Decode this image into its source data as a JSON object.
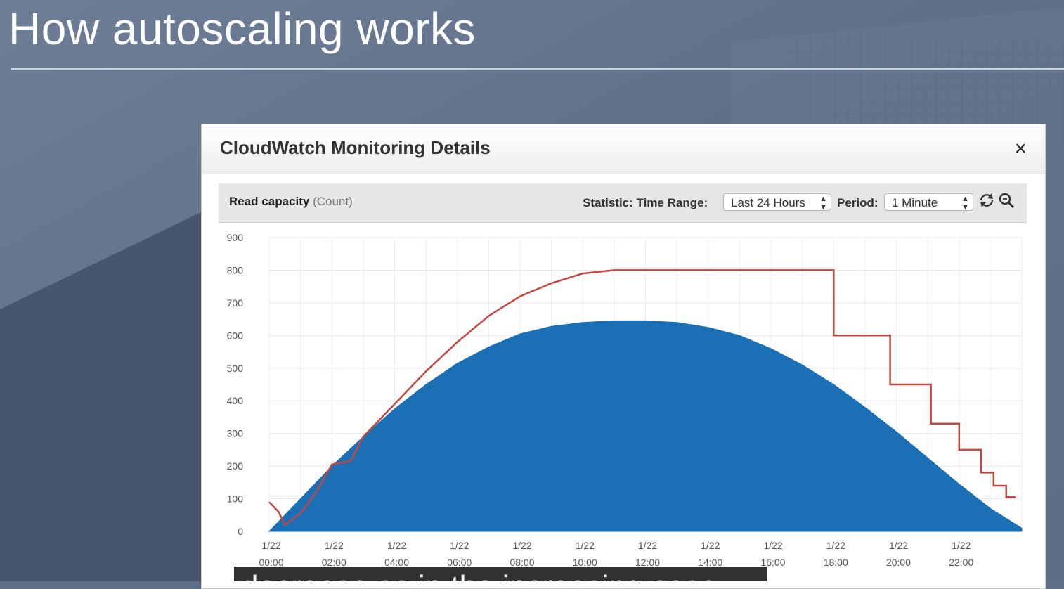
{
  "slide": {
    "title": "How autoscaling works"
  },
  "dialog": {
    "title": "CloudWatch Monitoring Details",
    "close_label": "×",
    "toolbar": {
      "metric_name": "Read capacity",
      "metric_unit": "(Count)",
      "statistic_label": "Statistic: Time Range:",
      "time_range_value": "Last 24 Hours",
      "period_label": "Period:",
      "period_value": "1 Minute",
      "refresh_icon": "refresh-icon",
      "zoom_icon": "zoom-icon"
    }
  },
  "chart_data": {
    "type": "area",
    "title": "Read capacity (Count)",
    "xlabel": "",
    "ylabel": "",
    "ylim": [
      0,
      900
    ],
    "xlim_hours": [
      0,
      24
    ],
    "y_ticks": [
      "0",
      "100",
      "200",
      "300",
      "400",
      "500",
      "600",
      "700",
      "800",
      "900"
    ],
    "x_ticks": [
      {
        "hour": 0,
        "label": "1/22 00:00"
      },
      {
        "hour": 2,
        "label": "1/22 02:00"
      },
      {
        "hour": 4,
        "label": "1/22 04:00"
      },
      {
        "hour": 6,
        "label": "1/22 06:00"
      },
      {
        "hour": 8,
        "label": "1/22 08:00"
      },
      {
        "hour": 10,
        "label": "1/22 10:00"
      },
      {
        "hour": 12,
        "label": "1/22 12:00"
      },
      {
        "hour": 14,
        "label": "1/22 14:00"
      },
      {
        "hour": 16,
        "label": "1/22 16:00"
      },
      {
        "hour": 18,
        "label": "1/22 18:00"
      },
      {
        "hour": 20,
        "label": "1/22 20:00"
      },
      {
        "hour": 22,
        "label": "1/22 22:00"
      }
    ],
    "grid": true,
    "series": [
      {
        "kind": "area",
        "color": "#1a6fb5",
        "points": [
          [
            0,
            0
          ],
          [
            1,
            100
          ],
          [
            2,
            200
          ],
          [
            3,
            290
          ],
          [
            4,
            375
          ],
          [
            5,
            450
          ],
          [
            6,
            515
          ],
          [
            7,
            565
          ],
          [
            8,
            605
          ],
          [
            9,
            628
          ],
          [
            10,
            640
          ],
          [
            11,
            645
          ],
          [
            12,
            645
          ],
          [
            13,
            640
          ],
          [
            14,
            625
          ],
          [
            15,
            600
          ],
          [
            16,
            560
          ],
          [
            17,
            510
          ],
          [
            18,
            450
          ],
          [
            19,
            380
          ],
          [
            20,
            305
          ],
          [
            21,
            225
          ],
          [
            22,
            145
          ],
          [
            23,
            70
          ],
          [
            24,
            10
          ]
        ]
      },
      {
        "kind": "line",
        "color": "#c2473f",
        "points": [
          [
            0,
            90
          ],
          [
            0.3,
            60
          ],
          [
            0.5,
            20
          ],
          [
            1,
            55
          ],
          [
            1.5,
            120
          ],
          [
            2,
            205
          ],
          [
            2.6,
            215
          ],
          [
            3,
            290
          ],
          [
            4,
            390
          ],
          [
            5,
            490
          ],
          [
            6,
            580
          ],
          [
            7,
            660
          ],
          [
            8,
            720
          ],
          [
            9,
            760
          ],
          [
            10,
            790
          ],
          [
            11,
            800
          ],
          [
            18,
            800
          ],
          [
            18,
            600
          ],
          [
            19.8,
            600
          ],
          [
            19.8,
            450
          ],
          [
            21.1,
            450
          ],
          [
            21.1,
            330
          ],
          [
            22,
            330
          ],
          [
            22,
            250
          ],
          [
            22.7,
            250
          ],
          [
            22.7,
            180
          ],
          [
            23.1,
            180
          ],
          [
            23.1,
            140
          ],
          [
            23.5,
            140
          ],
          [
            23.5,
            105
          ],
          [
            23.8,
            105
          ]
        ]
      }
    ]
  },
  "subtitle": {
    "text": "decrease as in the increasing case"
  }
}
